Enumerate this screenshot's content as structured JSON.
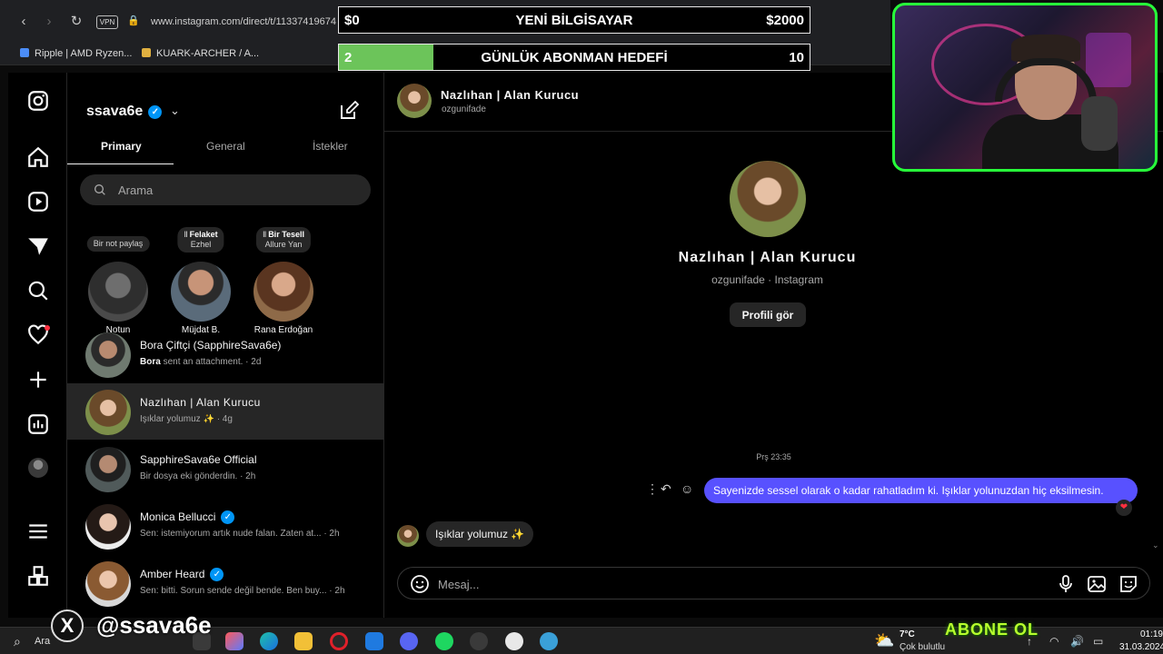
{
  "browser": {
    "url": "www.instagram.com/direct/t/11337419674",
    "vpn_label": "VPN",
    "bookmarks": [
      {
        "label": "Ripple | AMD Ryzen...",
        "color": "#4b8df8"
      },
      {
        "label": "KUARK-ARCHER / A...",
        "color": "#e0b040"
      }
    ]
  },
  "overlay": {
    "goal_computer": {
      "left": "$0",
      "title": "YENİ BİLGİSAYAR",
      "right": "$2000"
    },
    "goal_subs": {
      "left": "2",
      "title": "GÜNLÜK ABONMAN HEDEFİ",
      "right": "10",
      "progress": 0.2
    },
    "x_handle": "@ssava6e",
    "abone": "ABONE OL"
  },
  "instagram": {
    "username": "ssava6e",
    "tabs": [
      {
        "label": "Primary",
        "active": true
      },
      {
        "label": "General",
        "active": false
      },
      {
        "label": "İstekler",
        "active": false
      }
    ],
    "search_placeholder": "Arama",
    "notes": [
      {
        "bubble": "Bir not paylaş",
        "bubble_title": "",
        "name": "Notun"
      },
      {
        "bubble_title": "Felaket",
        "bubble": "Ezhel",
        "name": "Müjdat B."
      },
      {
        "bubble_title": "Bir Tesell",
        "bubble": "Allure Yan",
        "name": "Rana Erdoğan"
      }
    ],
    "threads": [
      {
        "name": "Bora Çiftçi (SapphireSava6e)",
        "preview_sender": "Bora",
        "preview": " sent an attachment. · 2d",
        "verified": false,
        "selected": false
      },
      {
        "name": "Nazlıhan | Alan Kurucu",
        "preview_sender": "",
        "preview": "Işıklar yolumuz ✨ · 4g",
        "verified": false,
        "selected": true
      },
      {
        "name": "SapphireSava6e Official",
        "preview_sender": "",
        "preview": "Bir dosya eki gönderdin. · 2h",
        "verified": false,
        "selected": false
      },
      {
        "name": "Monica Bellucci",
        "preview_sender": "",
        "preview": "Sen: istemiyorum artık nude falan. Zaten at... · 2h",
        "verified": true,
        "selected": false
      },
      {
        "name": "Amber Heard",
        "preview_sender": "",
        "preview": "Sen: bitti. Sorun sende değil bende. Ben buy... · 2h",
        "verified": true,
        "selected": false
      }
    ]
  },
  "chat": {
    "name": "Nazlıhan | Alan Kurucu",
    "username": "ozgunifade",
    "profile_sub": "ozgunifade · Instagram",
    "profile_button": "Profili gör",
    "timestamp": "Prş 23:35",
    "outgoing": "Sayenizde sessel olarak o kadar rahatladım ki. Işıklar yolunuzdan hiç eksilmesin.",
    "incoming": "Işıklar yolumuz ✨",
    "composer_placeholder": "Mesaj..."
  },
  "taskbar": {
    "search_text": "Ara",
    "temp": "7°C",
    "weather": "Çok bulutlu",
    "time": "01:19",
    "date": "31.03.2024"
  },
  "colors": {
    "accent": "#0095f6",
    "bubble_out": "#5851ff",
    "goal_fill": "#6cc45a",
    "webcam_border": "#27ff3a"
  }
}
